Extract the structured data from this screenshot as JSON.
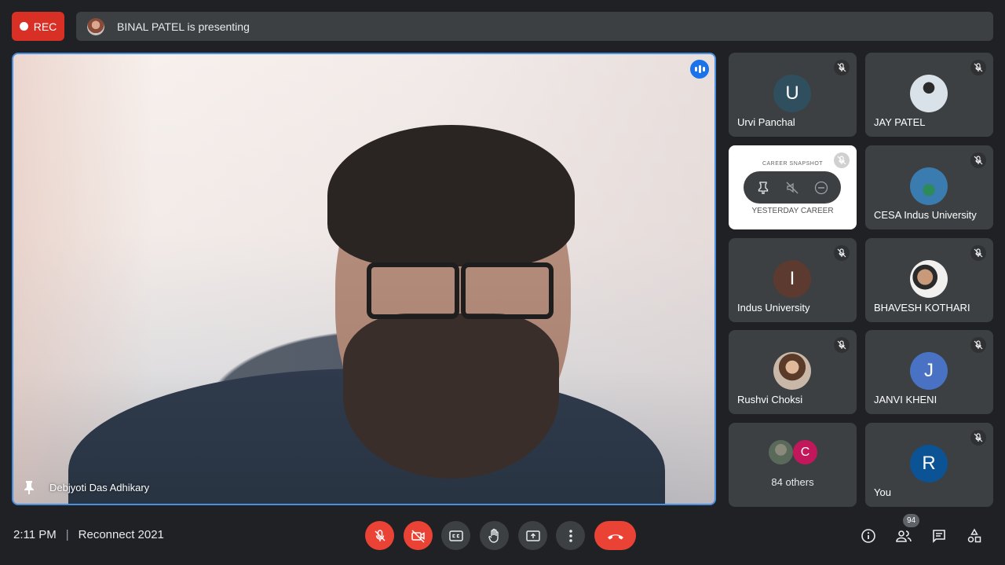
{
  "recording": {
    "label": "REC"
  },
  "presenting": {
    "text": "BINAL PATEL is presenting"
  },
  "main_speaker": {
    "name": "Debjyoti Das Adhikary"
  },
  "participants": [
    {
      "name": "Urvi Panchal",
      "initial": "U",
      "avatar_color": "#2f4f5f",
      "muted": true
    },
    {
      "name": "JAY PATEL",
      "initial": "",
      "avatar_color": "#8a9aa8",
      "muted": true
    },
    {
      "name": "",
      "initial": "",
      "avatar_color": "",
      "muted": true
    },
    {
      "name": "CESA Indus University",
      "initial": "",
      "avatar_color": "#3a7bb0",
      "muted": true
    },
    {
      "name": "Indus University",
      "initial": "I",
      "avatar_color": "#5d3a30",
      "muted": true
    },
    {
      "name": "BHAVESH KOTHARI",
      "initial": "",
      "avatar_color": "#e8e4e0",
      "muted": true
    },
    {
      "name": "Rushvi Choksi",
      "initial": "",
      "avatar_color": "#c7a58a",
      "muted": true
    },
    {
      "name": "JANVI KHENI",
      "initial": "J",
      "avatar_color": "#4a72c4",
      "muted": true
    },
    {
      "name": "You",
      "initial": "R",
      "avatar_color": "#0b5394",
      "muted": true
    }
  ],
  "shared_screen": {
    "caption": "CAREER SNAPSHOT",
    "bottom_text": "YESTERDAY CAREER"
  },
  "others": {
    "label": "84 others",
    "initial": "C",
    "avatar_color": "#c2185b"
  },
  "footer": {
    "time": "2:11 PM",
    "separator": "|",
    "meeting_name": "Reconnect 2021",
    "people_count": "94"
  }
}
